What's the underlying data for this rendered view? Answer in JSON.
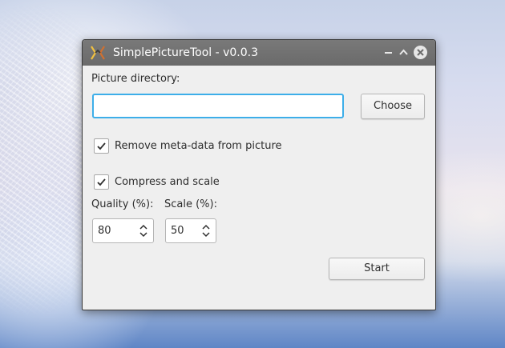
{
  "window": {
    "title": "SimplePictureTool - v0.0.3",
    "icon": "app-logo-icon",
    "controls": {
      "minimize": "–",
      "maximize": "^",
      "close": "✕"
    }
  },
  "form": {
    "picture_directory_label": "Picture directory:",
    "picture_directory_value": "",
    "choose_label": "Choose",
    "remove_meta_label": "Remove meta-data from picture",
    "remove_meta_checked": true,
    "compress_label": "Compress and scale",
    "compress_checked": true,
    "quality_label": "Quality (%):",
    "quality_value": "80",
    "scale_label": "Scale (%):",
    "scale_value": "50",
    "start_label": "Start"
  },
  "colors": {
    "focus_accent": "#3daee9",
    "titlebar": "#707070",
    "window_bg": "#efefef"
  }
}
